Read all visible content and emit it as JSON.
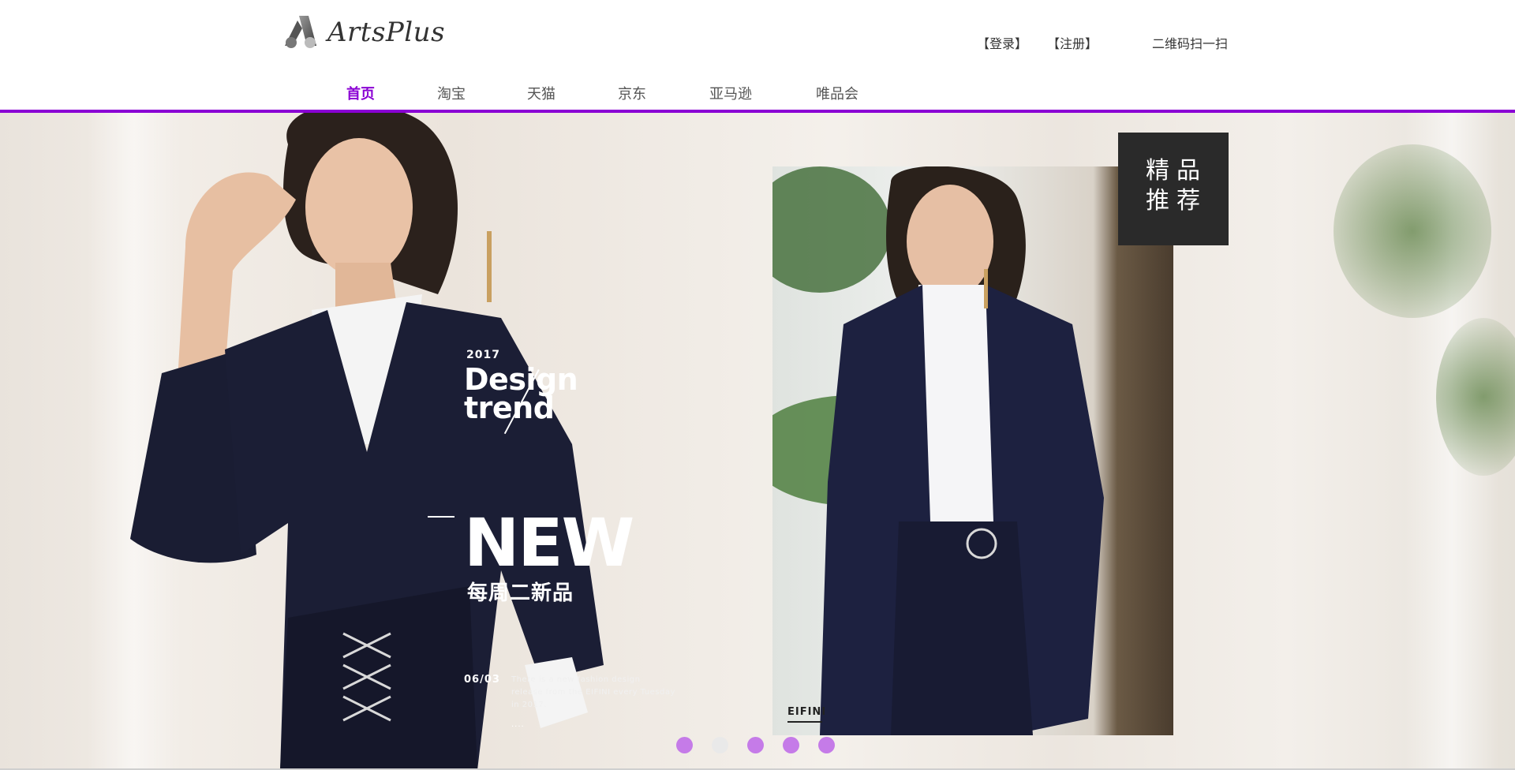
{
  "header": {
    "logo_text": "ArtsPlus",
    "login_label": "【登录】",
    "register_label": "【注册】",
    "qr_label": "二维码扫一扫"
  },
  "nav": {
    "items": [
      {
        "label": "首页",
        "active": true
      },
      {
        "label": "淘宝",
        "active": false
      },
      {
        "label": "天猫",
        "active": false
      },
      {
        "label": "京东",
        "active": false
      },
      {
        "label": "亚马逊",
        "active": false
      },
      {
        "label": "唯品会",
        "active": false
      }
    ]
  },
  "banner": {
    "year": "2017",
    "design_line1": "Design",
    "design_line2": "trend",
    "new_text": "NEW",
    "cn_tagline": "每周二新品",
    "date": "06/03",
    "desc_line1": "There is a new fashion design",
    "desc_line2": "release from the EIFINI every Tuesday",
    "desc_line3": "in 2017.",
    "desc_dots": "....",
    "photo_label": "EIFINI",
    "badge_line1": "精品",
    "badge_line2": "推荐"
  },
  "carousel": {
    "active_index": 1,
    "count": 5
  },
  "colors": {
    "accent": "#8a00d4",
    "dot_active": "#c57be8",
    "dot_inactive": "#e9e9e9",
    "badge_bg": "#2a2a2a"
  }
}
